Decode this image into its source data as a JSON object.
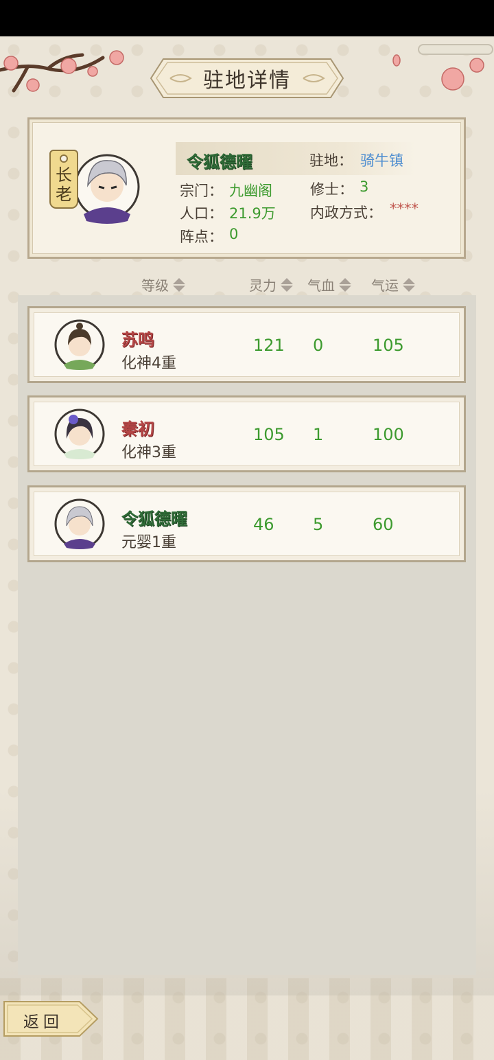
{
  "header": {
    "title": "驻地详情"
  },
  "station": {
    "rank_tag": [
      "长",
      "老"
    ],
    "leader_name": "令狐德曜",
    "location_label": "驻地：",
    "location_value": "骑牛镇",
    "sect_label": "宗门：",
    "sect_value": "九幽阁",
    "cultivators_label": "修士：",
    "cultivators_value": "3",
    "population_label": "人口：",
    "population_value": "21.9万",
    "governance_label": "内政方式：",
    "governance_value": "****",
    "formation_label": "阵点：",
    "formation_value": "0"
  },
  "sort_header": {
    "level": "等级",
    "spirit": "灵力",
    "blood": "气血",
    "luck": "气运"
  },
  "members": [
    {
      "name": "苏鸣",
      "realm": "化神4重",
      "spirit": "121",
      "blood": "0",
      "luck": "105",
      "name_color": "red"
    },
    {
      "name": "秦初",
      "realm": "化神3重",
      "spirit": "105",
      "blood": "1",
      "luck": "100",
      "name_color": "red"
    },
    {
      "name": "令狐德曜",
      "realm": "元婴1重",
      "spirit": "46",
      "blood": "5",
      "luck": "60",
      "name_color": "green"
    }
  ],
  "footer": {
    "back_label": "返回"
  },
  "colors": {
    "accent_green": "#3c9a2e",
    "link_blue": "#4f8ed0",
    "name_red": "#b44545"
  }
}
